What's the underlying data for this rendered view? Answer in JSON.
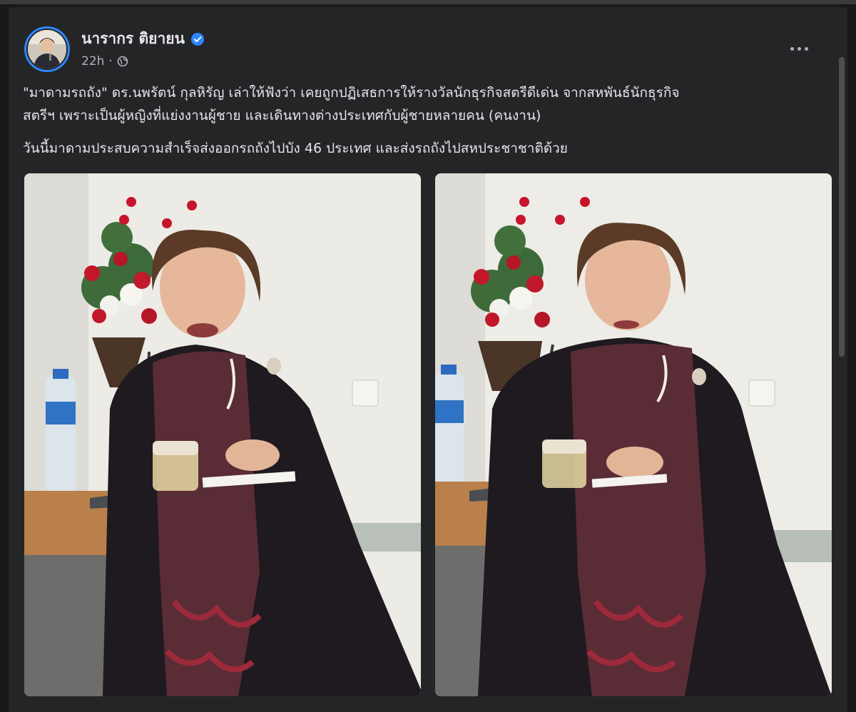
{
  "post": {
    "author": "นารากร ติยายน",
    "time": "22h",
    "privacy_separator": "·",
    "paragraphs": [
      "\"มาดามรถถัง\" ดร.นพรัตน์ กุลหิรัญ เล่าให้ฟังว่า เคยถูกปฏิเสธการให้รางวัลนักธุรกิจสตรีดีเด่น จากสหพันธ์นักธุรกิจ",
      "สตรีฯ เพราะเป็นผู้หญิงที่แย่งงานผู้ชาย และเดินทางต่างประเทศกับผู้ชายหลายคน (คนงาน)",
      "วันนี้มาดามประสบความสำเร็จส่งออกรถถังไปบัง 46 ประเทศ และส่งรถถังไปสหประชาชาติด้วย"
    ]
  },
  "icons": {
    "verified": "verified-badge-icon",
    "privacy": "globe-icon",
    "more": "more-options-icon"
  },
  "colors": {
    "background": "#18191a",
    "card": "#242526",
    "text_primary": "#e4e6eb",
    "text_secondary": "#b0b3b8",
    "verified_blue": "#2d88ff"
  }
}
